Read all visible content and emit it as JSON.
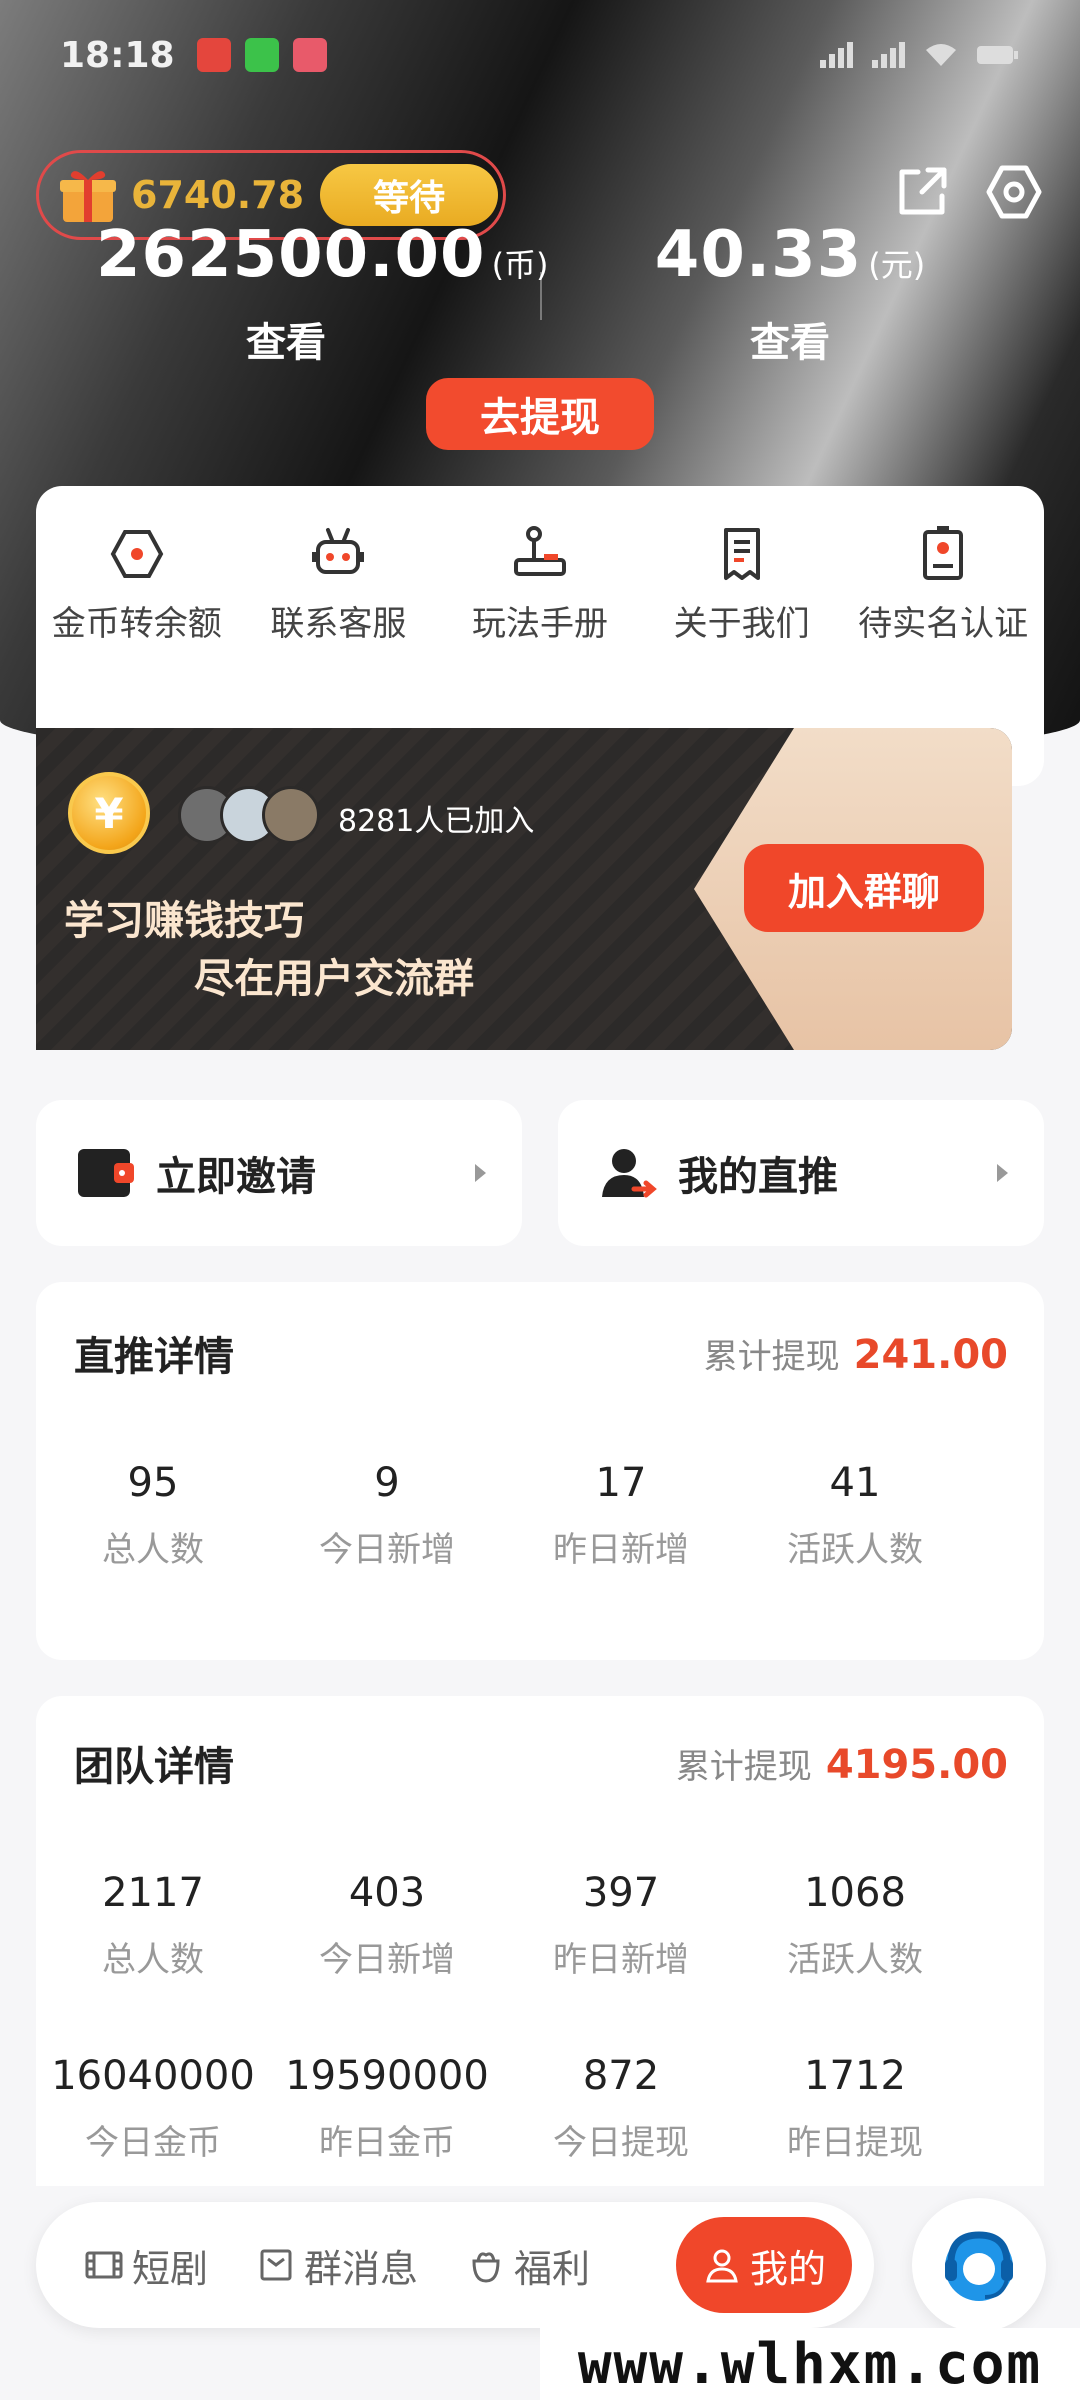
{
  "status": {
    "time": "18:18"
  },
  "gift": {
    "amount": "6740.78",
    "wait_label": "等待"
  },
  "balances": [
    {
      "value": "262500.00",
      "unit": "(币)",
      "action": "查看"
    },
    {
      "value": "40.33",
      "unit": "(元)",
      "action": "查看"
    }
  ],
  "withdraw_label": "去提现",
  "menu": [
    {
      "label": "金币转余额",
      "icon": "hexagon-icon"
    },
    {
      "label": "联系客服",
      "icon": "robot-icon"
    },
    {
      "label": "玩法手册",
      "icon": "joystick-icon"
    },
    {
      "label": "关于我们",
      "icon": "document-icon"
    },
    {
      "label": "待实名认证",
      "icon": "id-card-icon"
    }
  ],
  "banner": {
    "coin_symbol": "¥",
    "joined": "8281人已加入",
    "line1": "学习赚钱技巧",
    "line2": "尽在用户交流群",
    "join_label": "加入群聊"
  },
  "invite": {
    "label": "立即邀请"
  },
  "direct": {
    "label": "我的直推"
  },
  "direct_stats": {
    "title": "直推详情",
    "total_label": "累计提现",
    "total_value": "241.00",
    "items": [
      {
        "n": "95",
        "t": "总人数"
      },
      {
        "n": "9",
        "t": "今日新增"
      },
      {
        "n": "17",
        "t": "昨日新增"
      },
      {
        "n": "41",
        "t": "活跃人数"
      }
    ]
  },
  "team_stats": {
    "title": "团队详情",
    "total_label": "累计提现",
    "total_value": "4195.00",
    "items": [
      {
        "n": "2117",
        "t": "总人数"
      },
      {
        "n": "403",
        "t": "今日新增"
      },
      {
        "n": "397",
        "t": "昨日新增"
      },
      {
        "n": "1068",
        "t": "活跃人数"
      }
    ],
    "items2": [
      {
        "n": "16040000",
        "t": "今日金币"
      },
      {
        "n": "19590000",
        "t": "昨日金币"
      },
      {
        "n": "872",
        "t": "今日提现"
      },
      {
        "n": "1712",
        "t": "昨日提现"
      }
    ]
  },
  "tabs": [
    {
      "label": "短剧",
      "icon": "film-icon"
    },
    {
      "label": "群消息",
      "icon": "message-icon"
    },
    {
      "label": "福利",
      "icon": "gift-bag-icon"
    },
    {
      "label": "我的",
      "icon": "user-icon"
    }
  ],
  "watermark": "www.wlhxm.com",
  "colors": {
    "accent": "#f0472a",
    "gold": "#e9b43a",
    "dark": "#2c2a29"
  }
}
